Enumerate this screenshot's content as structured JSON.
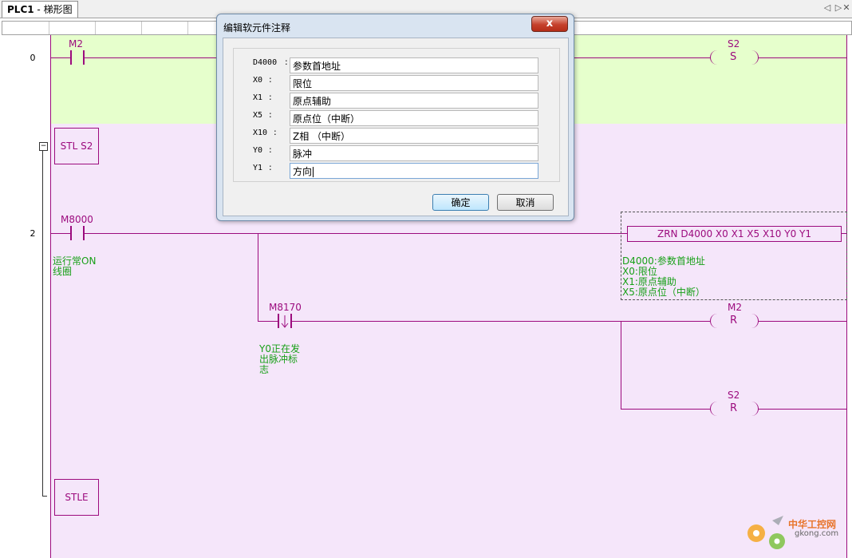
{
  "tab": {
    "name": "PLC1",
    "sep": " - ",
    "view": "梯形图"
  },
  "nav": {
    "prev": "◁",
    "next": "▷",
    "close": "✕"
  },
  "ladder": {
    "step0": "0",
    "step2": "2",
    "contact_m2": "M2",
    "coil_s2_set_label": "S2",
    "coil_s2_set_symbol": "S",
    "stl_s2": "STL S2",
    "contact_m8000": "M8000",
    "m8000_comment": [
      "运行常ON",
      "线圈"
    ],
    "zrn_instruction": "ZRN D4000 X0 X1 X5 X10 Y0 Y1",
    "zrn_comments": [
      "D4000:参数首地址",
      "X0:限位",
      "X1:原点辅助",
      "X5:原点位（中断）"
    ],
    "contact_m8170": "M8170",
    "m8170_comment": [
      "Y0正在发",
      "出脉冲标",
      "志"
    ],
    "coil_m2_reset_label": "M2",
    "coil_m2_reset_symbol": "R",
    "coil_s2_reset_label": "S2",
    "coil_s2_reset_symbol": "R",
    "stle": "STLE",
    "fold_symbol": "−"
  },
  "dialog": {
    "title": "编辑软元件注释",
    "close_label": "x",
    "fields": [
      {
        "label": "D4000",
        "value": "参数首地址"
      },
      {
        "label": "X0",
        "value": "限位"
      },
      {
        "label": "X1",
        "value": "原点辅助"
      },
      {
        "label": "X5",
        "value": "原点位（中断）"
      },
      {
        "label": "X10",
        "value": "Z相 （中断）"
      },
      {
        "label": "Y0",
        "value": "脉冲"
      },
      {
        "label": "Y1",
        "value": "方向"
      }
    ],
    "separator": ":",
    "ok_label": "确定",
    "cancel_label": "取消"
  },
  "watermark": {
    "text_cn": "中华工控网",
    "text_en": "gkong.com"
  },
  "colors": {
    "ladder_line": "#9c0b7e",
    "comment": "#18a018",
    "zone0_bg": "#e6ffcc",
    "zone2_bg": "#f5e6fa"
  }
}
